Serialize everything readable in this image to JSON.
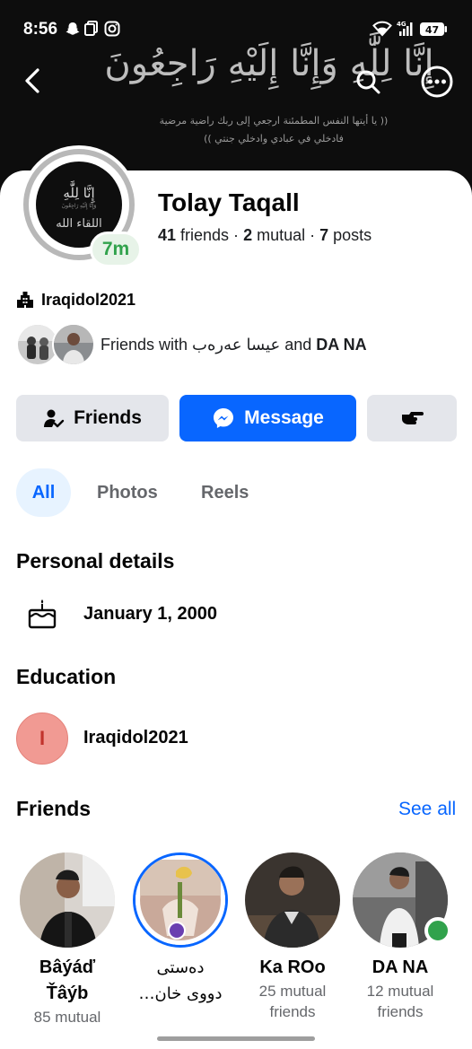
{
  "status_bar": {
    "time": "8:56",
    "battery": "47"
  },
  "cover": {
    "calligraphy": "إِنَّا لِلَّٰهِ وَإِنَّا إِلَيْهِ رَاجِعُونَ",
    "line1": "(( يا أيتها النفس المطمئنة ارجعي إلى ربك راضية مرضية",
    "line2": "فادخلي في عبادي وادخلي جنتي ))"
  },
  "header": {
    "back_icon": "back-arrow-icon",
    "search_icon": "search-icon",
    "more_icon": "more-icon"
  },
  "profile": {
    "avatar_text1": "إِنَّا لِلَّٰهِ",
    "avatar_text2": "وَإِنَّا إِلَيْهِ رَاجِعُونَ",
    "avatar_text3": "اللقاء الله",
    "active_badge": "7m",
    "name": "Tolay Taqall",
    "friends_count": "41",
    "friends_label": " friends · ",
    "mutual_count": "2",
    "mutual_label": " mutual · ",
    "posts_count": "7",
    "posts_label": " posts",
    "work": "Iraqidol2021",
    "mutual_prefix": "Friends with ",
    "mutual_name1": "عیسا عەرەب",
    "mutual_and": " and ",
    "mutual_name2": "DA NA"
  },
  "actions": {
    "friends": "Friends",
    "message": "Message"
  },
  "tabs": [
    "All",
    "Photos",
    "Reels"
  ],
  "personal": {
    "title": "Personal details",
    "birthday": "January 1, 2000"
  },
  "education": {
    "title": "Education",
    "initial": "I",
    "school": "Iraqidol2021"
  },
  "friends_section": {
    "title": "Friends",
    "see_all": "See all",
    "items": [
      {
        "name_line1": "Bâýáď",
        "name_line2": "Ťâýb",
        "mutual": "85 mutual"
      },
      {
        "name_line1": "دەستی",
        "name_line2": "دووی خان…",
        "mutual": ""
      },
      {
        "name_line1": "Ka ROo",
        "name_line2": "",
        "mutual": "25 mutual friends"
      },
      {
        "name_line1": "DA NA",
        "name_line2": "",
        "mutual": "12 mutual friends"
      }
    ]
  },
  "colors": {
    "accent": "#0866ff",
    "active_green": "#31a24c",
    "button_grey": "#e4e6eb"
  }
}
